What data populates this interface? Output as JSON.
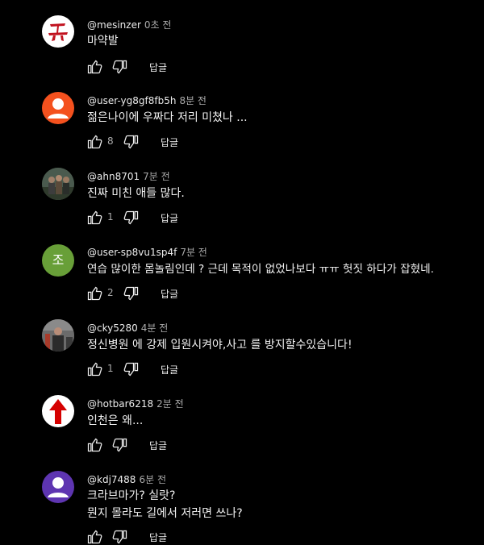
{
  "colors": {
    "background": "#000000",
    "text": "#f1f1f1",
    "meta": "#aaaaaa"
  },
  "comments": [
    {
      "author": "@mesinzer",
      "time": "0초 전",
      "lines": [
        "마약발"
      ],
      "likes": "",
      "reply_label": "답글",
      "avatar_icon": "red-calligraphy-avatar"
    },
    {
      "author": "@user-yg8gf8fb5h",
      "time": "8분 전",
      "lines": [
        "젊은나이에 우짜다 저리 미쳤나 ..."
      ],
      "likes": "8",
      "reply_label": "답글",
      "avatar_color": "#f4511e",
      "avatar_icon": "user-icon"
    },
    {
      "author": "@ahn8701",
      "time": "7분 전",
      "lines": [
        "진짜 미친 애들 많다."
      ],
      "likes": "1",
      "reply_label": "답글",
      "avatar_icon": "photo-avatar"
    },
    {
      "author": "@user-sp8vu1sp4f",
      "time": "7분 전",
      "lines": [
        "연습 많이한 몸놀림인데 ? 근데 목적이 없었나보다 ㅠㅠ 헛짓 하다가 잡혔네."
      ],
      "likes": "2",
      "reply_label": "답글",
      "avatar_color": "#689f38",
      "avatar_letter": "조"
    },
    {
      "author": "@cky5280",
      "time": "4분 전",
      "lines": [
        "정신병원 에 강제 입원시켜야,사고 를 방지할수있습니다!"
      ],
      "likes": "1",
      "reply_label": "답글",
      "avatar_icon": "photo-avatar"
    },
    {
      "author": "@hotbar6218",
      "time": "2분 전",
      "lines": [
        "인천은 왜..."
      ],
      "likes": "",
      "reply_label": "답글",
      "avatar_icon": "red-arrow-up-avatar"
    },
    {
      "author": "@kdj7488",
      "time": "6분 전",
      "lines": [
        "크라브마가? 실랏?",
        "뭔지 몰라도 길에서 저러면 쓰나?"
      ],
      "likes": "",
      "reply_label": "답글",
      "avatar_color": "#5e35b1",
      "avatar_icon": "user-icon"
    }
  ]
}
